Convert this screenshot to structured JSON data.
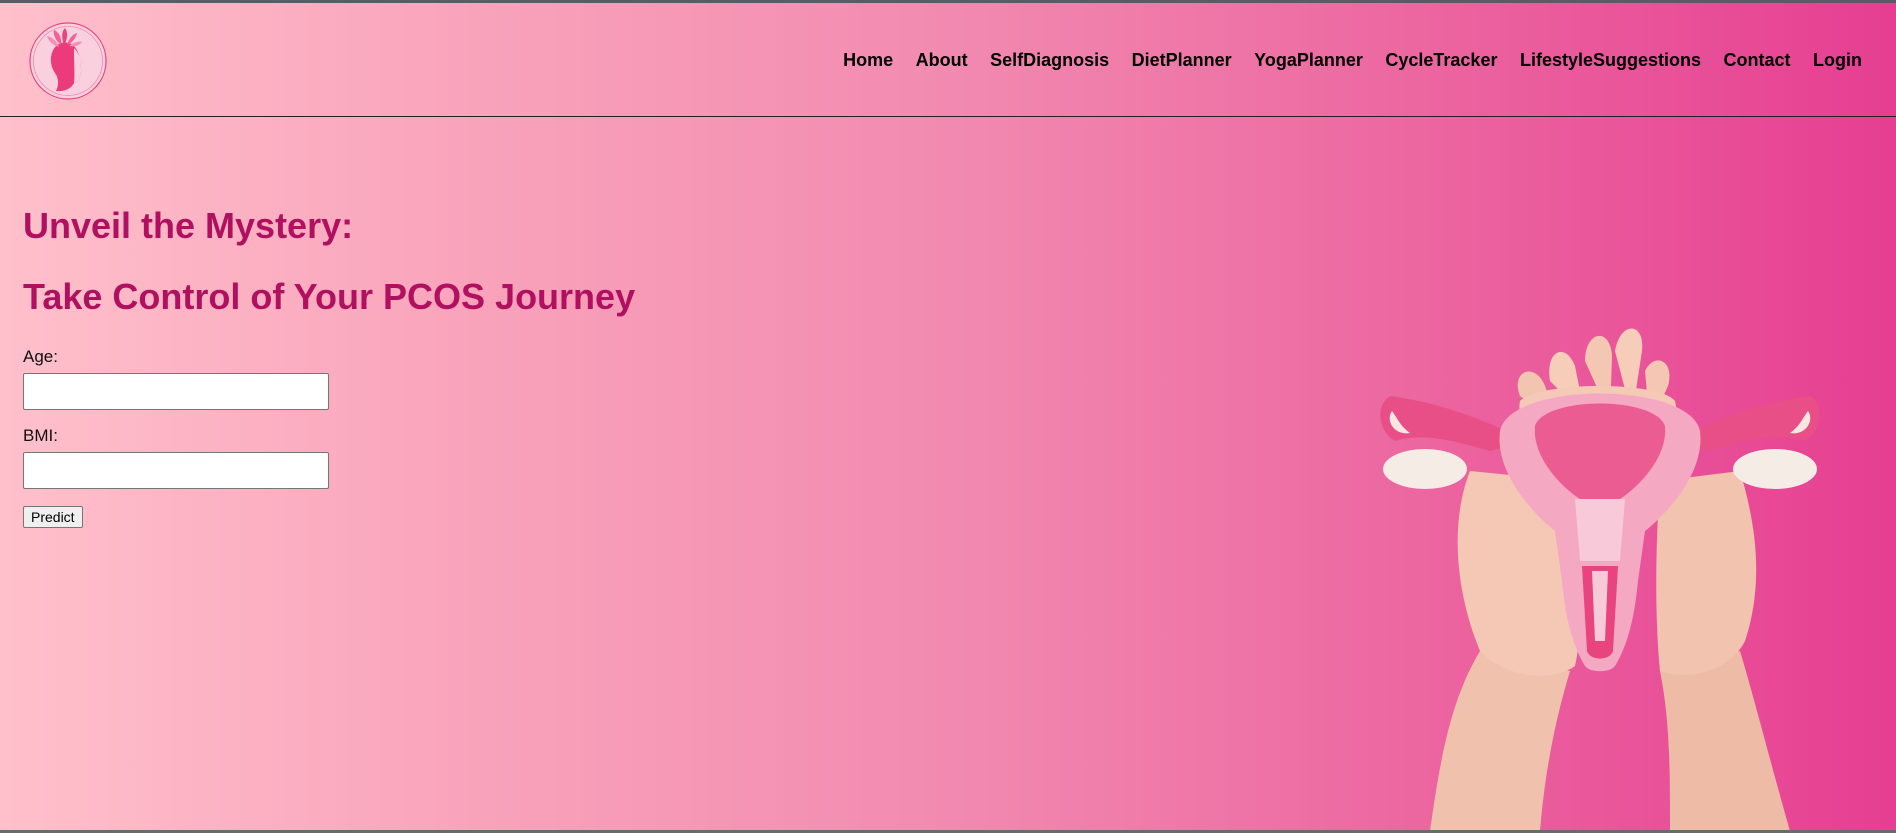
{
  "nav": {
    "items": [
      {
        "label": "Home",
        "name": "nav-home"
      },
      {
        "label": "About",
        "name": "nav-about"
      },
      {
        "label": "SelfDiagnosis",
        "name": "nav-selfdiagnosis"
      },
      {
        "label": "DietPlanner",
        "name": "nav-dietplanner"
      },
      {
        "label": "YogaPlanner",
        "name": "nav-yogaplanner"
      },
      {
        "label": "CycleTracker",
        "name": "nav-cycletracker"
      },
      {
        "label": "LifestyleSuggestions",
        "name": "nav-lifestylesuggestions"
      },
      {
        "label": "Contact",
        "name": "nav-contact"
      },
      {
        "label": "Login",
        "name": "nav-login"
      }
    ]
  },
  "hero": {
    "headline_1": "Unveil the Mystery:",
    "headline_2": "Take Control of Your PCOS Journey"
  },
  "form": {
    "age_label": "Age:",
    "age_value": "",
    "bmi_label": "BMI:",
    "bmi_value": "",
    "predict_label": "Predict"
  },
  "colors": {
    "headline": "#b0105f",
    "gradient_start": "#ffc0cb",
    "gradient_end": "#e63e92"
  },
  "icons": {
    "logo": "woman-profile-lotus-logo",
    "illustration": "hands-holding-paper-uterus"
  }
}
